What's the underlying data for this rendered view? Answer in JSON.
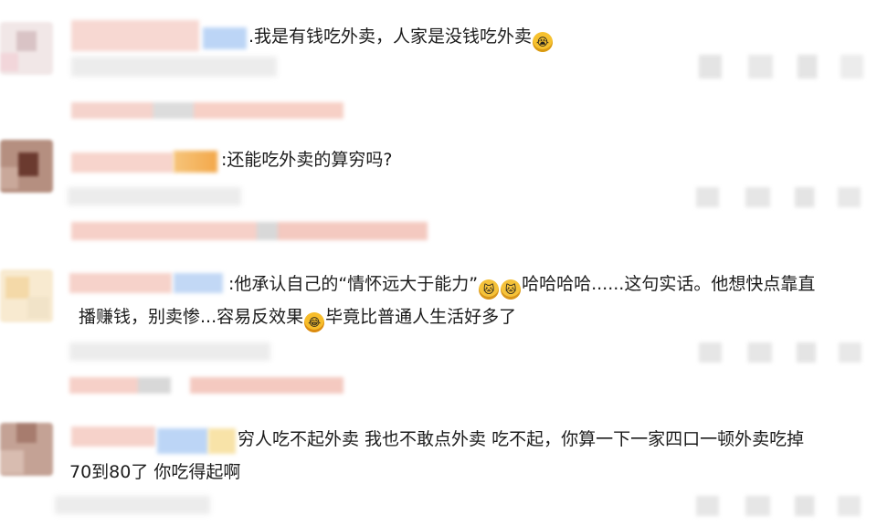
{
  "colors": {
    "pink": "#f7cfc8",
    "pink_light": "#fbe3de",
    "blue": "#b9d3f5",
    "orange": "#f6b35b",
    "gray": "#e3e3e3",
    "gray_dark": "#cfcfcf",
    "brown": "#8a5a4a"
  },
  "comments": [
    {
      "text": ".我是有钱吃外卖，人家是没钱吃外卖",
      "emoji": "cry-emoji-icon"
    },
    {
      "text": ":还能吃外卖的算穷吗?"
    },
    {
      "line1_a": ":他承认自己的“情怀远大于能力”",
      "line1_b": "哈哈哈哈......这句实话。他想快点靠直",
      "line2_a": "播赚钱，别卖惨...容易反效果",
      "line2_b": "毕竟比普通人生活好多了",
      "emoji1": "cat-emoji-icon",
      "emoji2": "cat-emoji-icon",
      "emoji3": "laugh-emoji-icon"
    },
    {
      "line1": "穷人吃不起外卖 我也不敢点外卖 吃不起，你算一下一家四口一顿外卖吃掉",
      "line2": "70到80了 你吃得起啊"
    }
  ]
}
